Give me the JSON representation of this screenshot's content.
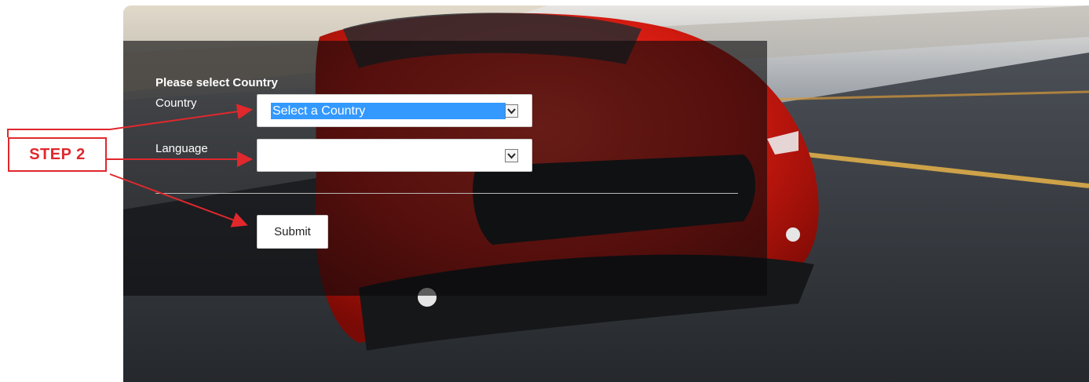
{
  "form": {
    "title": "Please select Country",
    "country_label": "Country",
    "country_selected": "Select a Country",
    "language_label": "Language",
    "language_selected": "",
    "submit_label": "Submit"
  },
  "annotation": {
    "step_label": "STEP 2",
    "color": "#e0282d"
  },
  "icons": {
    "select_arrow": "chevron-down-icon"
  }
}
